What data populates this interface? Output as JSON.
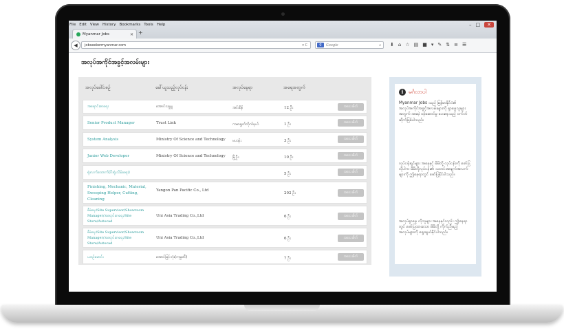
{
  "browser": {
    "menu": [
      "File",
      "Edit",
      "View",
      "History",
      "Bookmarks",
      "Tools",
      "Help"
    ],
    "tab_title": "Myanmar Jobs",
    "new_tab": "+",
    "url": "jobseekermyanmar.com",
    "search_engine": "Google",
    "search_placeholder": "Google"
  },
  "page": {
    "title": "အလုပ်အကိုင်အခွင့်အလမ်းများ",
    "columns": {
      "job_title": "အလုပ်ခေါင်းစဉ်",
      "company": "ခေါ်ယူသည့်လုပ်ငန်း",
      "location": "အလုပ်နေရာ",
      "vacancies": "အရေအတွက်"
    },
    "jobs": [
      {
        "title": "အရောင်းစာရေး",
        "company": "အောင်သမ္ဘူ",
        "location": "အင်းစိန်",
        "count": "12 ဦး",
        "button": "အသေးစိတ်"
      },
      {
        "title": "Senior Product Manager",
        "company": "Trust Link",
        "location": "ကမာရွတ်တိုက်နယ်",
        "count": "1 ဦး",
        "button": "အသေးစိတ်"
      },
      {
        "title": "System Analysis",
        "company": "Ministry Of Science and Technology",
        "location": "ဗဟန်း",
        "count": "3 ဦး",
        "button": "အသေးစိတ်"
      },
      {
        "title": "Junior Web Developer",
        "company": "Ministry Of Science and Technology",
        "location": "မြို့ဦး",
        "count": "10 ဦး",
        "button": "အသေးစိတ်"
      },
      {
        "title": "ရုံးလက်ထောက်(ဝီးရုံးသိမ်းရေး)",
        "company": "",
        "location": "",
        "count": "5 ဦး",
        "button": "အသေးစိတ်"
      },
      {
        "title": "Finishing, Mechanic, Material, Sweeping Helper, Cutting, Cleaning",
        "company": "Yangon Pan Pacific Co., Ltd",
        "location": "",
        "count": "202 ဦး",
        "button": "အသေးစိတ်"
      },
      {
        "title": "စီမံရေး/Site Supervisor/Showroom Manager/အရောင်းစာရေး/Site Store/Autocad",
        "company": "Uni Asia Trading Co.,Ltd",
        "location": "",
        "count": "6 ဦး",
        "button": "အသေးစိတ်"
      },
      {
        "title": "စီမံရေး/Site Supervisor/Showroom Manager/အရောင်းစာရေး/Site Store/Autocad",
        "company": "Uni Asia Trading Co.,Ltd",
        "location": "",
        "count": "6 ဦး",
        "button": "အသေးစိတ်"
      },
      {
        "title": "ယာဉ်မောင်း",
        "company": "အောင်မြင့်ဘုံး(ကုမ္ပဏီ)",
        "location": "",
        "count": "7 ဦး",
        "button": "အသေးစိတ်"
      }
    ]
  },
  "sidebar": {
    "title": "မင်္ဂလာပါ",
    "paragraphs": [
      "Myanmar Jobs သည် မြန်မာနိုင်ငံ၏ အလုပ်အကိုင်အခွင့်အလမ်းများကို ရှာဖွေသူများအတွက် အခမဲ့ ဝန်ဆောင်မှု ပေးနေသည့် ဝက်ဘ်ဆိုက်ဖြစ်ပါသည်။",
      "လုပ်ငန်းရှင်များ အနေနှင့် မိမိတို့ လုပ်ငန်းကို ဖော်ပြလိုပါက မိမိတို့လုပ်ငန်း၏ သတင်းအချက်အလက်များကို ဤနေရာတွင် ဖော်ပြနိုင်ပါသည်။",
      "အလုပ်ရှာဖွေ လိုသူများ အနေနှင့်လည်း ဤနေရာတွင် ဖော်ပြထားသော မိမိတို့ ကိုက်ညီမည့် အလုပ်များကို ရွေးချယ်နိုင်ပါသည်။"
    ]
  }
}
